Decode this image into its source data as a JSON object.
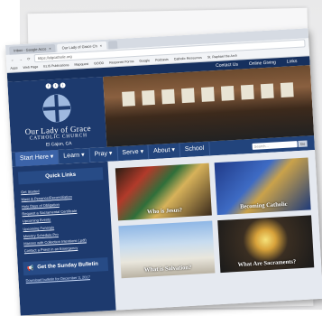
{
  "browser": {
    "tabs": [
      {
        "label": "Inbox - Google Acco",
        "active": false
      },
      {
        "label": "Our Lady of Grace Ch",
        "active": true
      },
      {
        "label": "",
        "active": false
      }
    ],
    "address": "https://olgcatholic.org",
    "bookmarks": [
      "Apps",
      "Web Page",
      "ELIS Publications",
      "Mapquest",
      "GOOD",
      "Response Forms",
      "Google",
      "Podcasts",
      "Catholic Resources",
      "St. Raphael the Arch"
    ]
  },
  "site": {
    "topbar": [
      "Contact Us",
      "Online Giving",
      "Links"
    ],
    "social": [
      "f",
      "t",
      "i"
    ],
    "brand": {
      "line1": "Our Lady of Grace",
      "line2": "CATHOLIC CHURCH",
      "line3": "El Cajon, CA"
    },
    "nav": [
      {
        "label": "Start Here ▾"
      },
      {
        "label": "Learn ▾"
      },
      {
        "label": "Pray ▾"
      },
      {
        "label": "Serve ▾"
      },
      {
        "label": "About ▾"
      },
      {
        "label": "School"
      }
    ],
    "search": {
      "placeholder": "Search...",
      "button": "Go"
    },
    "quick_links": {
      "title": "Quick Links",
      "items": [
        "Get Started",
        "Mass & Penance/Reconciliation",
        "Holy Days of Obligation",
        "Request a Sacramental Certificate",
        "Upcoming Events",
        "Upcoming Funerals",
        "Ministry Schedule Pro",
        "Masses with Collection Intentions (.pdf)",
        "Contact a Priest in an Emergency"
      ]
    },
    "bulletin": {
      "title": "Get the Sunday Bulletin",
      "sub": "Download bulletin for December 3, 2017"
    },
    "tiles": [
      {
        "label": "Who is Jesus?"
      },
      {
        "label": "Becoming Catholic"
      },
      {
        "label": "What is Salvation?"
      },
      {
        "label": "What Are Sacraments?"
      }
    ]
  }
}
